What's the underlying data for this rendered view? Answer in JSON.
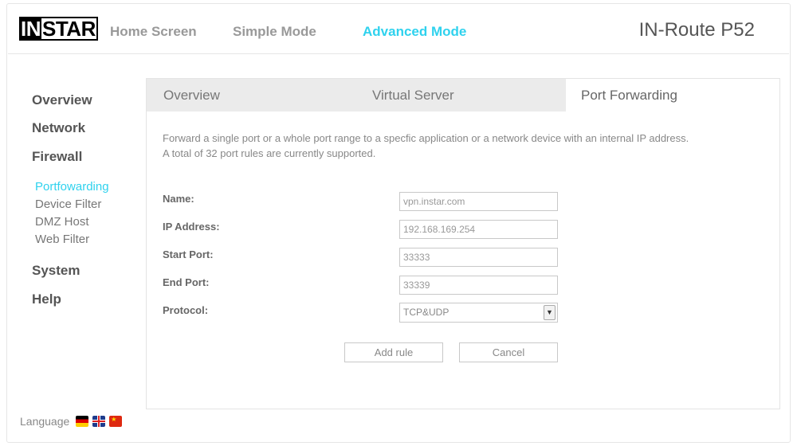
{
  "header": {
    "logo_part1": "IN",
    "logo_part2": "STAR",
    "nav": [
      "Home Screen",
      "Simple Mode",
      "Advanced Mode"
    ],
    "device_title": "IN-Route P52"
  },
  "sidebar": {
    "overview": "Overview",
    "network": "Network",
    "firewall": "Firewall",
    "sub_items": [
      "Portfowarding",
      "Device Filter",
      "DMZ Host",
      "Web Filter"
    ],
    "system": "System",
    "help": "Help"
  },
  "language": {
    "label": "Language",
    "flags": [
      "de-flag-icon",
      "uk-flag-icon",
      "cn-flag-icon"
    ]
  },
  "tabs": [
    "Overview",
    "Virtual Server",
    "Port Forwarding"
  ],
  "content": {
    "desc_line1": "Forward a single port or a whole port range to a specfic application or a network device with an internal IP address.",
    "desc_line2": "A total of 32 port rules are currently supported."
  },
  "form": {
    "name_label": "Name:",
    "name_value": "vpn.instar.com",
    "ip_label": "IP Address:",
    "ip_value": "192.168.169.254",
    "start_label": "Start Port:",
    "start_value": "33333",
    "end_label": "End Port:",
    "end_value": "33339",
    "protocol_label": "Protocol:",
    "protocol_value": "TCP&UDP"
  },
  "buttons": {
    "add": "Add rule",
    "cancel": "Cancel"
  },
  "colors": {
    "accent": "#2fd2ee",
    "tab_bar": "#ebebeb"
  }
}
